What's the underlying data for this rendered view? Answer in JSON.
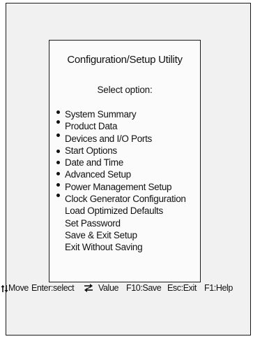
{
  "dialog": {
    "title": "Configuration/Setup Utility",
    "prompt": "Select  option:"
  },
  "menu": {
    "items": [
      {
        "label": "System Summary",
        "bullet": true
      },
      {
        "label": "Product Data",
        "bullet": true
      },
      {
        "label": "Devices and I/O Ports",
        "bullet": true
      },
      {
        "label": "Start Options",
        "bullet": true
      },
      {
        "label": "Date and Time",
        "bullet": true
      },
      {
        "label": "Advanced Setup",
        "bullet": true
      },
      {
        "label": "Power Management Setup",
        "bullet": true
      },
      {
        "label": "Clock Generator Configuration",
        "bullet": true
      },
      {
        "label": "Load Optimized Defaults",
        "bullet": false
      },
      {
        "label": "Set Password",
        "bullet": false
      },
      {
        "label": "Save & Exit Setup",
        "bullet": false
      },
      {
        "label": "Exit Without Saving",
        "bullet": false
      }
    ]
  },
  "footer": {
    "move_icon": "up-down-arrows-icon",
    "move_label": "Move",
    "select_label": "Enter:select",
    "value_icon": "value-change-arrows-icon",
    "value_label": "Value",
    "save_label": "F10:Save",
    "exit_label": "Esc:Exit",
    "help_label": "F1:Help"
  },
  "colors": {
    "frame_background": "#f1f1f1",
    "text": "#111111",
    "border": "#1a1a1a"
  }
}
